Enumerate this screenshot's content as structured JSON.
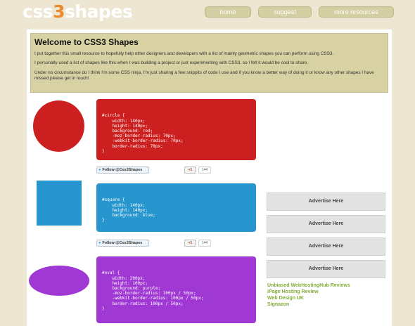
{
  "header": {
    "logo_prefix": "css",
    "logo_digit": "3",
    "logo_suffix": "shapes",
    "nav": [
      "home",
      "suggest",
      "more resources"
    ]
  },
  "intro": {
    "title": "Welcome to CSS3 Shapes",
    "paragraphs": [
      "I put together this small resource to hopefully help other designers and developers with a list of mainly geometric shapes you can perform using CSS3.",
      "I personally used a list of shapes like this when I was building a project or just experimenting with CSS3, so I felt it would be cool to share.",
      "Under no circumstance do I think I'm some CSS ninja, I'm just sharing a few snippits of code I use and if you know a better way of doing it or know any other shapes I have missed please get in touch!"
    ]
  },
  "shapes": [
    {
      "name": "circle",
      "color": "#cc1f1f",
      "code": [
        "#circle {",
        "    width: 140px;",
        "    height: 140px;",
        "    background: red;",
        "    -moz-border-radius: 70px;",
        "    -webkit-border-radius: 70px;",
        "    border-radius: 70px;",
        "}"
      ]
    },
    {
      "name": "square",
      "color": "#2796cf",
      "code": [
        "#square {",
        "    width: 140px;",
        "    height: 140px;",
        "    background: blue;",
        "}"
      ]
    },
    {
      "name": "oval",
      "color": "#a039d4",
      "code": [
        "#oval {",
        "    width: 200px;",
        "    height: 100px;",
        "    background: purple;",
        "    -moz-border-radius: 100px / 50px;",
        "    -webkit-border-radius: 100px / 50px;",
        "    border-radius: 100px / 50px;",
        "}"
      ]
    }
  ],
  "social": {
    "twitter_label": "Follow @Css3Shapes",
    "gplus_label": "+1",
    "gplus_count": "144"
  },
  "sidebar": {
    "ads": [
      "Advertise Here",
      "Advertise Here",
      "Advertise Here",
      "Advertise Here"
    ],
    "links": [
      "Unbiased WebHostingHub Reviews",
      "iPage Hosting Review",
      "Web Design UK",
      "Signazon"
    ]
  }
}
